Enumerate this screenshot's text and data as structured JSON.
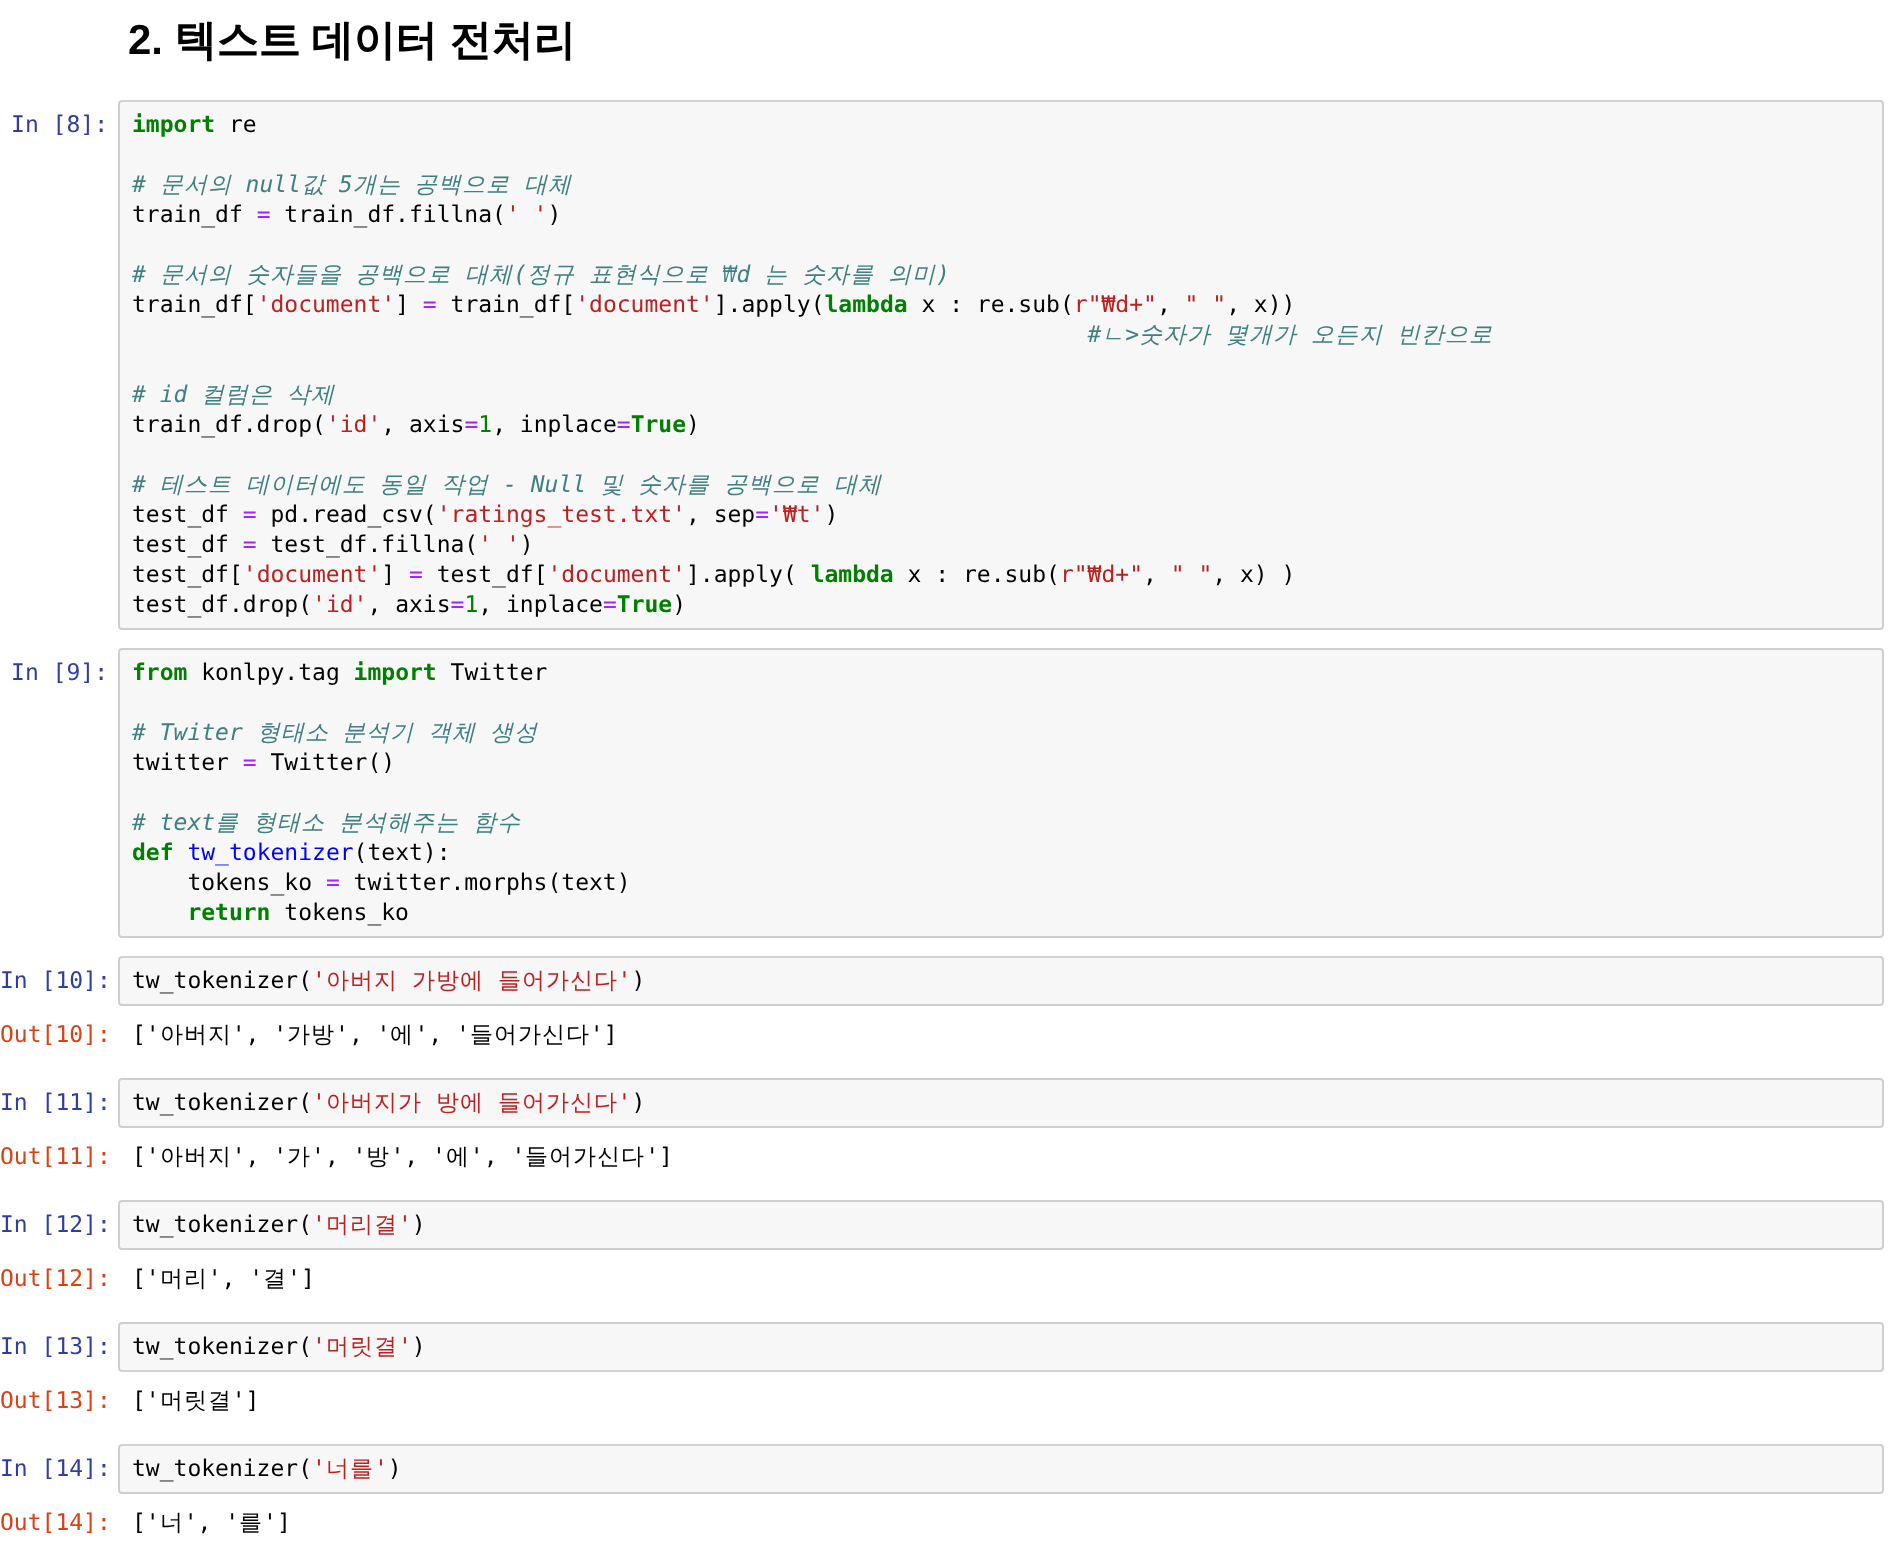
{
  "heading": "2. 텍스트 데이터 전처리",
  "cells": [
    {
      "prompt": "In [8]:",
      "blocks": [
        [
          [
            {
              "kind": "kw",
              "text": "import"
            },
            {
              "kind": "plain",
              "text": " re"
            }
          ]
        ],
        [
          [
            {
              "kind": "cmt",
              "text": "# 문서의 null값 5개는 공백으로 대체"
            }
          ],
          [
            {
              "kind": "plain",
              "text": "train_df "
            },
            {
              "kind": "op",
              "text": "="
            },
            {
              "kind": "plain",
              "text": " train_df.fillna("
            },
            {
              "kind": "str",
              "text": "' '"
            },
            {
              "kind": "plain",
              "text": ")"
            }
          ]
        ],
        [
          [
            {
              "kind": "cmt",
              "text": "# 문서의 숫자들을 공백으로 대체(정규 표현식으로 ₩d 는 숫자를 의미)"
            }
          ],
          [
            {
              "kind": "plain",
              "text": "train_df["
            },
            {
              "kind": "str",
              "text": "'document'"
            },
            {
              "kind": "plain",
              "text": "] "
            },
            {
              "kind": "op",
              "text": "="
            },
            {
              "kind": "plain",
              "text": " train_df["
            },
            {
              "kind": "str",
              "text": "'document'"
            },
            {
              "kind": "plain",
              "text": "].apply("
            },
            {
              "kind": "kw",
              "text": "lambda"
            },
            {
              "kind": "plain",
              "text": " x : re.sub("
            },
            {
              "kind": "str",
              "text": "r\"₩d+\""
            },
            {
              "kind": "plain",
              "text": ", "
            },
            {
              "kind": "str",
              "text": "\" \""
            },
            {
              "kind": "plain",
              "text": ", x))"
            }
          ],
          [
            {
              "kind": "cmt",
              "text": "                                                                     #ㄴ>숫자가 몇개가 오든지 빈칸으로"
            }
          ]
        ],
        [
          [
            {
              "kind": "cmt",
              "text": "# id 컬럼은 삭제"
            }
          ],
          [
            {
              "kind": "plain",
              "text": "train_df.drop("
            },
            {
              "kind": "str",
              "text": "'id'"
            },
            {
              "kind": "plain",
              "text": ", axis"
            },
            {
              "kind": "op",
              "text": "="
            },
            {
              "kind": "num",
              "text": "1"
            },
            {
              "kind": "plain",
              "text": ", inplace"
            },
            {
              "kind": "op",
              "text": "="
            },
            {
              "kind": "kw",
              "text": "True"
            },
            {
              "kind": "plain",
              "text": ")"
            }
          ]
        ],
        [
          [
            {
              "kind": "cmt",
              "text": "# 테스트 데이터에도 동일 작업 - Null 및 숫자를 공백으로 대체"
            }
          ],
          [
            {
              "kind": "plain",
              "text": "test_df "
            },
            {
              "kind": "op",
              "text": "="
            },
            {
              "kind": "plain",
              "text": " pd.read_csv("
            },
            {
              "kind": "str",
              "text": "'ratings_test.txt'"
            },
            {
              "kind": "plain",
              "text": ", sep"
            },
            {
              "kind": "op",
              "text": "="
            },
            {
              "kind": "str",
              "text": "'₩t'"
            },
            {
              "kind": "plain",
              "text": ")"
            }
          ],
          [
            {
              "kind": "plain",
              "text": "test_df "
            },
            {
              "kind": "op",
              "text": "="
            },
            {
              "kind": "plain",
              "text": " test_df.fillna("
            },
            {
              "kind": "str",
              "text": "' '"
            },
            {
              "kind": "plain",
              "text": ")"
            }
          ],
          [
            {
              "kind": "plain",
              "text": "test_df["
            },
            {
              "kind": "str",
              "text": "'document'"
            },
            {
              "kind": "plain",
              "text": "] "
            },
            {
              "kind": "op",
              "text": "="
            },
            {
              "kind": "plain",
              "text": " test_df["
            },
            {
              "kind": "str",
              "text": "'document'"
            },
            {
              "kind": "plain",
              "text": "].apply( "
            },
            {
              "kind": "kw",
              "text": "lambda"
            },
            {
              "kind": "plain",
              "text": " x : re.sub("
            },
            {
              "kind": "str",
              "text": "r\"₩d+\""
            },
            {
              "kind": "plain",
              "text": ", "
            },
            {
              "kind": "str",
              "text": "\" \""
            },
            {
              "kind": "plain",
              "text": ", x) )"
            }
          ],
          [
            {
              "kind": "plain",
              "text": "test_df.drop("
            },
            {
              "kind": "str",
              "text": "'id'"
            },
            {
              "kind": "plain",
              "text": ", axis"
            },
            {
              "kind": "op",
              "text": "="
            },
            {
              "kind": "num",
              "text": "1"
            },
            {
              "kind": "plain",
              "text": ", inplace"
            },
            {
              "kind": "op",
              "text": "="
            },
            {
              "kind": "kw",
              "text": "True"
            },
            {
              "kind": "plain",
              "text": ")"
            }
          ]
        ]
      ]
    },
    {
      "prompt": "In [9]:",
      "blocks": [
        [
          [
            {
              "kind": "kw",
              "text": "from"
            },
            {
              "kind": "plain",
              "text": " konlpy.tag "
            },
            {
              "kind": "kw",
              "text": "import"
            },
            {
              "kind": "plain",
              "text": " Twitter"
            }
          ]
        ],
        [
          [
            {
              "kind": "cmt",
              "text": "# Twiter 형태소 분석기 객체 생성"
            }
          ],
          [
            {
              "kind": "plain",
              "text": "twitter "
            },
            {
              "kind": "op",
              "text": "="
            },
            {
              "kind": "plain",
              "text": " Twitter()"
            }
          ]
        ],
        [
          [
            {
              "kind": "cmt",
              "text": "# text를 형태소 분석해주는 함수"
            }
          ],
          [
            {
              "kind": "kw",
              "text": "def "
            },
            {
              "kind": "fn",
              "text": "tw_tokenizer"
            },
            {
              "kind": "plain",
              "text": "(text):"
            }
          ],
          [
            {
              "kind": "plain",
              "text": "    tokens_ko "
            },
            {
              "kind": "op",
              "text": "="
            },
            {
              "kind": "plain",
              "text": " twitter.morphs(text)"
            }
          ],
          [
            {
              "kind": "kw",
              "text": "    return"
            },
            {
              "kind": "plain",
              "text": " tokens_ko"
            }
          ]
        ]
      ]
    },
    {
      "prompt": "In [10]:",
      "blocks": [
        [
          [
            {
              "kind": "plain",
              "text": "tw_tokenizer("
            },
            {
              "kind": "str",
              "text": "'아버지 가방에 들어가신다'"
            },
            {
              "kind": "plain",
              "text": ")"
            }
          ]
        ]
      ],
      "output_prompt": "Out[10]:",
      "output": "['아버지', '가방', '에', '들어가신다']"
    },
    {
      "prompt": "In [11]:",
      "blocks": [
        [
          [
            {
              "kind": "plain",
              "text": "tw_tokenizer("
            },
            {
              "kind": "str",
              "text": "'아버지가 방에 들어가신다'"
            },
            {
              "kind": "plain",
              "text": ")"
            }
          ]
        ]
      ],
      "output_prompt": "Out[11]:",
      "output": "['아버지', '가', '방', '에', '들어가신다']"
    },
    {
      "prompt": "In [12]:",
      "blocks": [
        [
          [
            {
              "kind": "plain",
              "text": "tw_tokenizer("
            },
            {
              "kind": "str",
              "text": "'머리결'"
            },
            {
              "kind": "plain",
              "text": ")"
            }
          ]
        ]
      ],
      "output_prompt": "Out[12]:",
      "output": "['머리', '결']"
    },
    {
      "prompt": "In [13]:",
      "blocks": [
        [
          [
            {
              "kind": "plain",
              "text": "tw_tokenizer("
            },
            {
              "kind": "str",
              "text": "'머릿결'"
            },
            {
              "kind": "plain",
              "text": ")"
            }
          ]
        ]
      ],
      "output_prompt": "Out[13]:",
      "output": "['머릿결']"
    },
    {
      "prompt": "In [14]:",
      "blocks": [
        [
          [
            {
              "kind": "plain",
              "text": "tw_tokenizer("
            },
            {
              "kind": "str",
              "text": "'너를'"
            },
            {
              "kind": "plain",
              "text": ")"
            }
          ]
        ]
      ],
      "output_prompt": "Out[14]:",
      "output": "['너', '를']"
    }
  ]
}
